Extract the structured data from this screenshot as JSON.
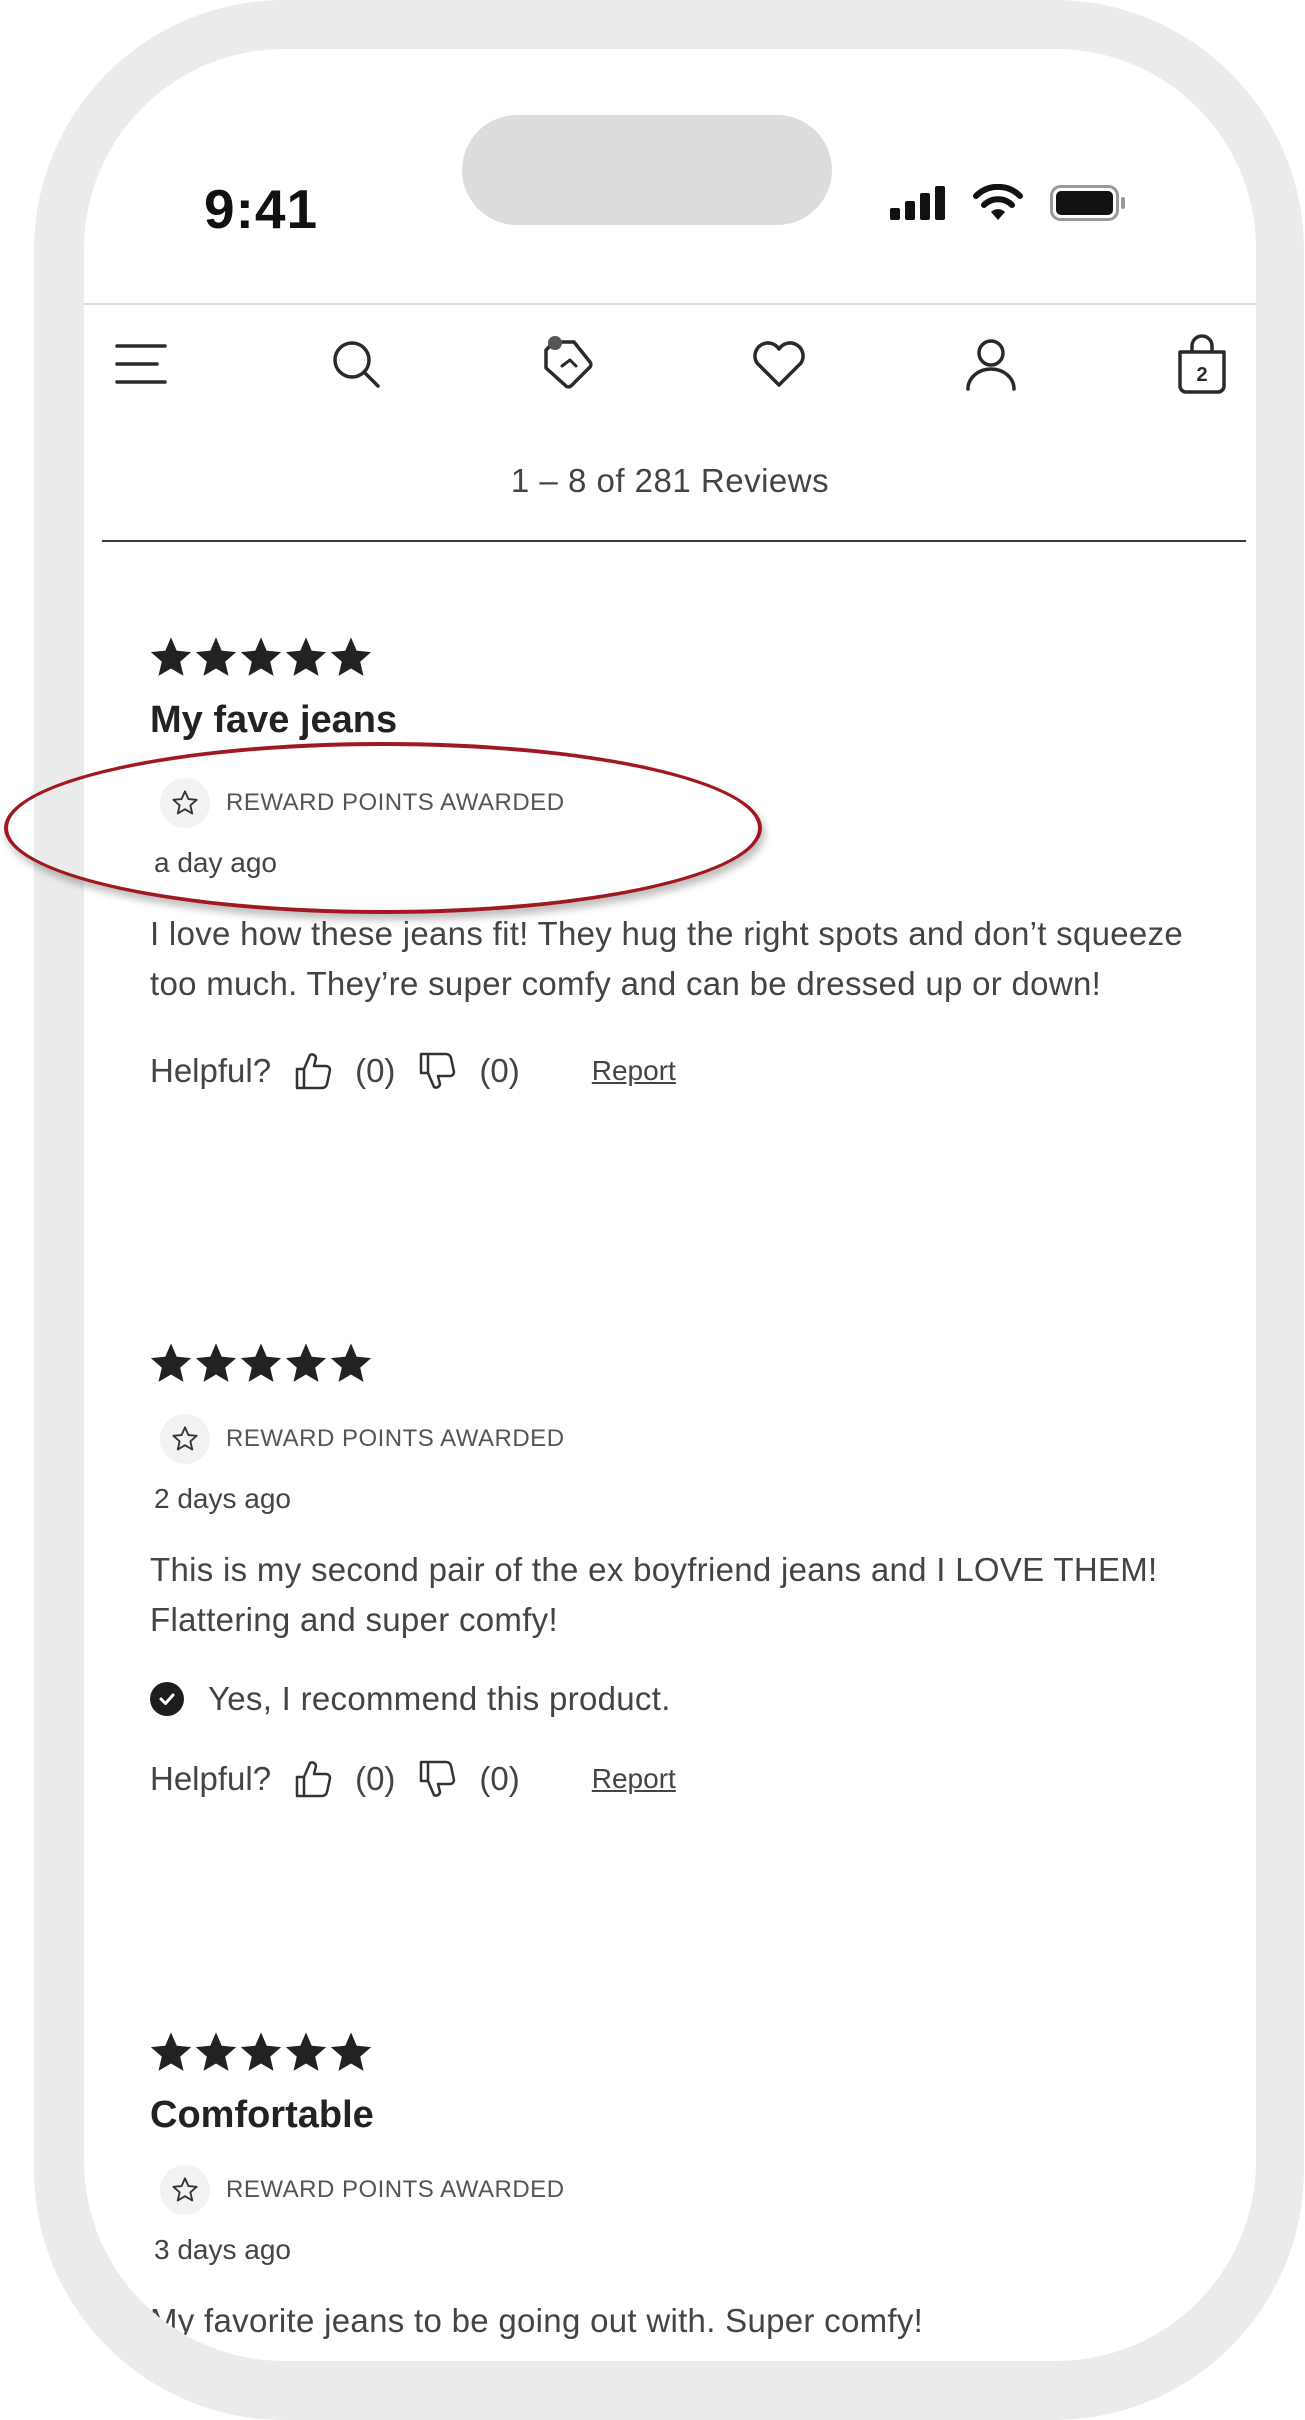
{
  "status_bar": {
    "time": "9:41"
  },
  "nav": {
    "items": [
      {
        "name": "menu-icon"
      },
      {
        "name": "search-icon"
      },
      {
        "name": "tag-icon"
      },
      {
        "name": "heart-icon"
      },
      {
        "name": "account-icon"
      },
      {
        "name": "bag-icon"
      }
    ],
    "bag_count": "2"
  },
  "reviews_header": {
    "count_text": "1 – 8 of 281 Reviews"
  },
  "reviews": [
    {
      "rating": 5,
      "title": "My fave jeans",
      "reward_label": "REWARD POINTS AWARDED",
      "date": "a day ago",
      "body": "I love how these jeans fit! They hug the right spots and don’t squeeze too much. They’re super comfy and can be dressed up or down!",
      "helpful_label": "Helpful?",
      "up_count": "(0)",
      "down_count": "(0)",
      "report_label": "Report"
    },
    {
      "rating": 5,
      "title": "",
      "reward_label": "REWARD POINTS AWARDED",
      "date": "2 days ago",
      "body": "This is my second pair of the ex boyfriend jeans and I LOVE THEM! Flattering and super comfy!",
      "recommend_text": "Yes, I recommend this product.",
      "helpful_label": "Helpful?",
      "up_count": "(0)",
      "down_count": "(0)",
      "report_label": "Report"
    },
    {
      "rating": 5,
      "title": "Comfortable",
      "reward_label": "REWARD POINTS AWARDED",
      "date": "3 days ago",
      "body": "My favorite jeans to be going out with. Super comfy!"
    }
  ],
  "colors": {
    "highlight": "#a01820",
    "frame": "#ebebeb",
    "text": "#444444",
    "star": "#222222"
  }
}
